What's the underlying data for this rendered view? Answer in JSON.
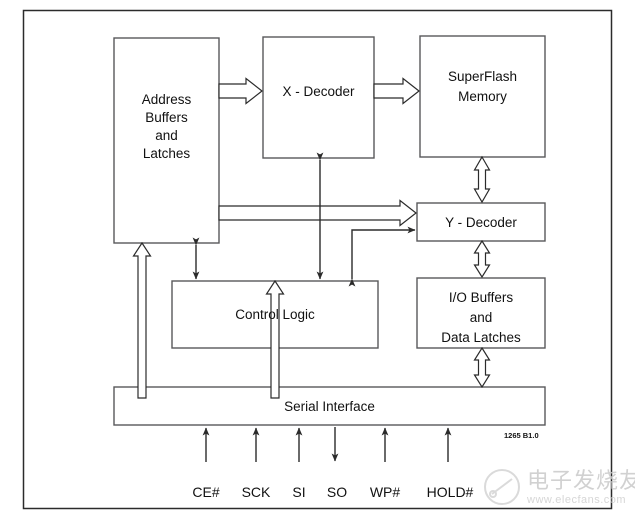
{
  "figure": {
    "caption": "1265 B1.0",
    "watermark_cn": "电子发烧友",
    "watermark_url": "www.elecfans.com"
  },
  "blocks": [
    {
      "id": "address-buffers",
      "lines": [
        "Address",
        "Buffers",
        "and",
        "Latches"
      ]
    },
    {
      "id": "x-decoder",
      "lines": [
        "X - Decoder"
      ]
    },
    {
      "id": "superflash-memory",
      "lines": [
        "SuperFlash",
        "Memory"
      ]
    },
    {
      "id": "y-decoder",
      "lines": [
        "Y - Decoder"
      ]
    },
    {
      "id": "io-buffers",
      "lines": [
        "I/O Buffers",
        "and",
        "Data Latches"
      ]
    },
    {
      "id": "control-logic",
      "lines": [
        "Control Logic"
      ]
    },
    {
      "id": "serial-interface",
      "lines": [
        "Serial Interface"
      ]
    }
  ],
  "block_text": {
    "address_buffers_l1": "Address",
    "address_buffers_l2": "Buffers",
    "address_buffers_l3": "and",
    "address_buffers_l4": "Latches",
    "x_decoder": "X - Decoder",
    "superflash_l1": "SuperFlash",
    "superflash_l2": "Memory",
    "y_decoder": "Y - Decoder",
    "io_buffers_l1": "I/O Buffers",
    "io_buffers_l2": "and",
    "io_buffers_l3": "Data Latches",
    "control_logic": "Control Logic",
    "serial_interface": "Serial Interface"
  },
  "pins": [
    {
      "name": "CE#",
      "direction": "input"
    },
    {
      "name": "SCK",
      "direction": "input"
    },
    {
      "name": "SI",
      "direction": "input"
    },
    {
      "name": "SO",
      "direction": "output"
    },
    {
      "name": "WP#",
      "direction": "input"
    },
    {
      "name": "HOLD#",
      "direction": "input"
    }
  ],
  "pin_labels": {
    "ce": "CE#",
    "sck": "SCK",
    "si": "SI",
    "so": "SO",
    "wp": "WP#",
    "hold": "HOLD#"
  },
  "colors": {
    "box_stroke": "#58585a",
    "line_stroke": "#2b2b2b",
    "text": "#111111",
    "background": "#ffffff",
    "watermark": "#cfcfcf"
  }
}
